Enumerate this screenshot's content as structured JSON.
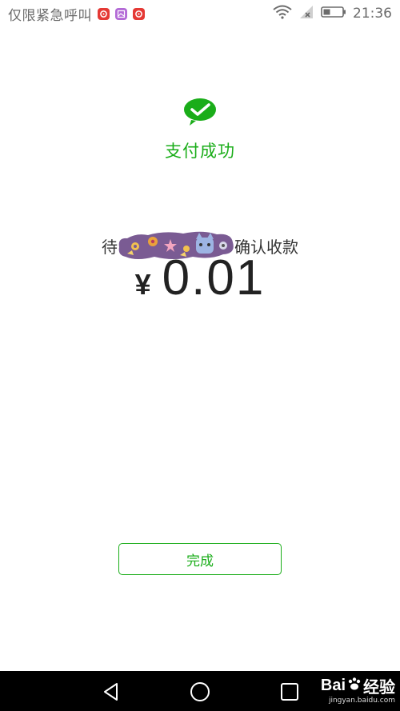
{
  "status_bar": {
    "carrier": "仅限紧急呼叫",
    "time": "21:36",
    "icons": [
      "netease-music-icon",
      "gallery-icon",
      "netease-music-icon",
      "wifi-icon",
      "no-signal-icon",
      "battery-icon"
    ]
  },
  "success": {
    "title": "支付成功"
  },
  "payee": {
    "prefix": "待",
    "suffix": "确认收款"
  },
  "payment": {
    "currency": "¥",
    "amount": "0.01"
  },
  "actions": {
    "done_label": "完成"
  },
  "watermark": {
    "logo_left": "Bai",
    "logo_right": "经验",
    "url": "jingyan.baidu.com"
  },
  "colors": {
    "accent": "#1aad19",
    "text": "#333333",
    "status": "#6b6b6b"
  }
}
